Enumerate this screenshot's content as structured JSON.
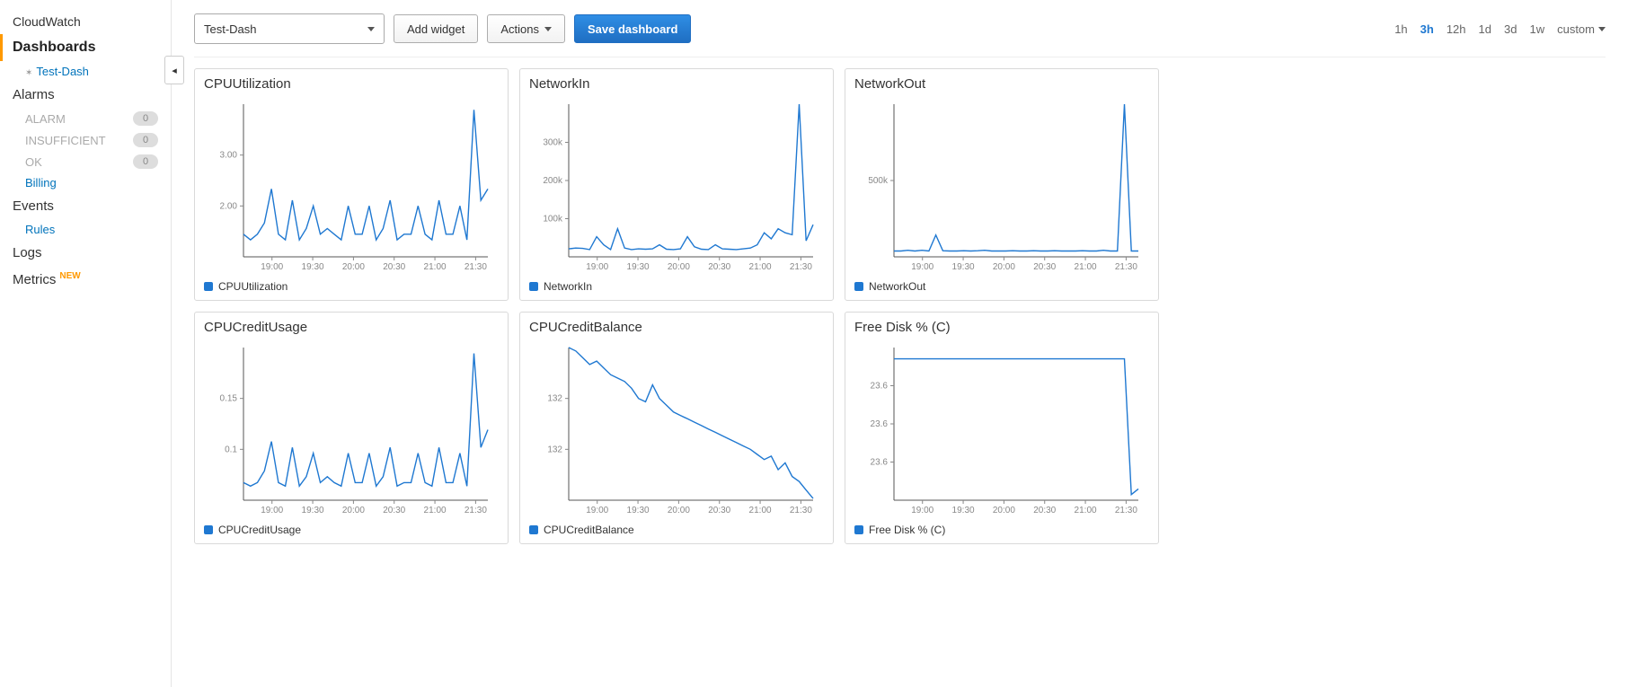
{
  "sidebar": {
    "top_label": "CloudWatch",
    "active_label": "Dashboards",
    "dash_item": "Test-Dash",
    "alarms_label": "Alarms",
    "alarm_states": [
      {
        "label": "ALARM",
        "count": "0"
      },
      {
        "label": "INSUFFICIENT",
        "count": "0"
      },
      {
        "label": "OK",
        "count": "0"
      }
    ],
    "billing_label": "Billing",
    "events_label": "Events",
    "rules_label": "Rules",
    "logs_label": "Logs",
    "metrics_label": "Metrics",
    "new_badge": "NEW"
  },
  "toolbar": {
    "dashboard_selected": "Test-Dash",
    "add_widget": "Add widget",
    "actions": "Actions",
    "save": "Save dashboard",
    "time_ranges": [
      "1h",
      "3h",
      "12h",
      "1d",
      "3d",
      "1w",
      "custom"
    ],
    "time_active": "3h"
  },
  "x_ticks": [
    "19:00",
    "19:30",
    "20:00",
    "20:30",
    "21:00",
    "21:30"
  ],
  "widgets": [
    {
      "title": "CPUUtilization",
      "legend": "CPUUtilization"
    },
    {
      "title": "NetworkIn",
      "legend": "NetworkIn"
    },
    {
      "title": "NetworkOut",
      "legend": "NetworkOut"
    },
    {
      "title": "CPUCreditUsage",
      "legend": "CPUCreditUsage"
    },
    {
      "title": "CPUCreditBalance",
      "legend": "CPUCreditBalance"
    },
    {
      "title": "Free Disk % (C)",
      "legend": "Free Disk % (C)"
    }
  ],
  "chart_data": [
    {
      "type": "line",
      "title": "CPUUtilization",
      "xlabel": "",
      "ylabel": "",
      "y_ticks": [
        "2.00",
        "3.00"
      ],
      "ylim": [
        1.3,
        4.0
      ],
      "x": [
        0,
        1,
        2,
        3,
        4,
        5,
        6,
        7,
        8,
        9,
        10,
        11,
        12,
        13,
        14,
        15,
        16,
        17,
        18,
        19,
        20,
        21,
        22,
        23,
        24,
        25,
        26,
        27,
        28,
        29,
        30,
        31,
        32,
        33,
        34,
        35
      ],
      "values": [
        1.7,
        1.6,
        1.7,
        1.9,
        2.5,
        1.7,
        1.6,
        2.3,
        1.6,
        1.8,
        2.2,
        1.7,
        1.8,
        1.7,
        1.6,
        2.2,
        1.7,
        1.7,
        2.2,
        1.6,
        1.8,
        2.3,
        1.6,
        1.7,
        1.7,
        2.2,
        1.7,
        1.6,
        2.3,
        1.7,
        1.7,
        2.2,
        1.6,
        3.9,
        2.3,
        2.5
      ]
    },
    {
      "type": "line",
      "title": "NetworkIn",
      "xlabel": "",
      "ylabel": "",
      "y_ticks": [
        "100k",
        "200k",
        "300k"
      ],
      "ylim": [
        0,
        380000
      ],
      "x": [
        0,
        1,
        2,
        3,
        4,
        5,
        6,
        7,
        8,
        9,
        10,
        11,
        12,
        13,
        14,
        15,
        16,
        17,
        18,
        19,
        20,
        21,
        22,
        23,
        24,
        25,
        26,
        27,
        28,
        29,
        30,
        31,
        32,
        33,
        34,
        35
      ],
      "values": [
        20000,
        22000,
        21000,
        18000,
        50000,
        30000,
        18000,
        70000,
        22000,
        18000,
        20000,
        19000,
        20000,
        30000,
        19000,
        18000,
        20000,
        50000,
        25000,
        19000,
        18000,
        30000,
        20000,
        19000,
        18000,
        20000,
        22000,
        30000,
        60000,
        45000,
        70000,
        60000,
        55000,
        380000,
        40000,
        80000
      ]
    },
    {
      "type": "line",
      "title": "NetworkOut",
      "xlabel": "",
      "ylabel": "",
      "y_ticks": [
        "500k"
      ],
      "ylim": [
        0,
        1050000
      ],
      "x": [
        0,
        1,
        2,
        3,
        4,
        5,
        6,
        7,
        8,
        9,
        10,
        11,
        12,
        13,
        14,
        15,
        16,
        17,
        18,
        19,
        20,
        21,
        22,
        23,
        24,
        25,
        26,
        27,
        28,
        29,
        30,
        31,
        32,
        33,
        34,
        35
      ],
      "values": [
        40000,
        40000,
        45000,
        40000,
        45000,
        40000,
        150000,
        42000,
        40000,
        40000,
        42000,
        40000,
        42000,
        45000,
        40000,
        40000,
        40000,
        42000,
        40000,
        40000,
        42000,
        40000,
        40000,
        42000,
        40000,
        40000,
        40000,
        42000,
        40000,
        40000,
        45000,
        40000,
        40000,
        1050000,
        40000,
        40000
      ]
    },
    {
      "type": "line",
      "title": "CPUCreditUsage",
      "xlabel": "",
      "ylabel": "",
      "y_ticks": [
        "0.1",
        "0.15"
      ],
      "ylim": [
        0.07,
        0.2
      ],
      "x": [
        0,
        1,
        2,
        3,
        4,
        5,
        6,
        7,
        8,
        9,
        10,
        11,
        12,
        13,
        14,
        15,
        16,
        17,
        18,
        19,
        20,
        21,
        22,
        23,
        24,
        25,
        26,
        27,
        28,
        29,
        30,
        31,
        32,
        33,
        34,
        35
      ],
      "values": [
        0.085,
        0.082,
        0.085,
        0.095,
        0.12,
        0.085,
        0.082,
        0.115,
        0.082,
        0.09,
        0.11,
        0.085,
        0.09,
        0.085,
        0.082,
        0.11,
        0.085,
        0.085,
        0.11,
        0.082,
        0.09,
        0.115,
        0.082,
        0.085,
        0.085,
        0.11,
        0.085,
        0.082,
        0.115,
        0.085,
        0.085,
        0.11,
        0.082,
        0.195,
        0.115,
        0.13
      ]
    },
    {
      "type": "line",
      "title": "CPUCreditBalance",
      "xlabel": "",
      "ylabel": "",
      "y_ticks": [
        "132",
        "132"
      ],
      "ylim": [
        127,
        136
      ],
      "x": [
        0,
        1,
        2,
        3,
        4,
        5,
        6,
        7,
        8,
        9,
        10,
        11,
        12,
        13,
        14,
        15,
        16,
        17,
        18,
        19,
        20,
        21,
        22,
        23,
        24,
        25,
        26,
        27,
        28,
        29,
        30,
        31,
        32,
        33,
        34,
        35
      ],
      "values": [
        136,
        135.8,
        135.4,
        135,
        135.2,
        134.8,
        134.4,
        134.2,
        134,
        133.6,
        133,
        132.8,
        133.8,
        133,
        132.6,
        132.2,
        132,
        131.8,
        131.6,
        131.4,
        131.2,
        131,
        130.8,
        130.6,
        130.4,
        130.2,
        130,
        129.7,
        129.4,
        129.6,
        128.8,
        129.2,
        128.4,
        128.1,
        127.6,
        127.1
      ]
    },
    {
      "type": "line",
      "title": "Free Disk % (C)",
      "xlabel": "",
      "ylabel": "",
      "y_ticks": [
        "23.6",
        "23.6",
        "23.6"
      ],
      "ylim": [
        23.45,
        23.72
      ],
      "x": [
        0,
        1,
        2,
        3,
        4,
        5,
        6,
        7,
        8,
        9,
        10,
        11,
        12,
        13,
        14,
        15,
        16,
        17,
        18,
        19,
        20,
        21,
        22,
        23,
        24,
        25,
        26,
        27,
        28,
        29,
        30,
        31,
        32,
        33,
        34,
        35
      ],
      "values": [
        23.7,
        23.7,
        23.7,
        23.7,
        23.7,
        23.7,
        23.7,
        23.7,
        23.7,
        23.7,
        23.7,
        23.7,
        23.7,
        23.7,
        23.7,
        23.7,
        23.7,
        23.7,
        23.7,
        23.7,
        23.7,
        23.7,
        23.7,
        23.7,
        23.7,
        23.7,
        23.7,
        23.7,
        23.7,
        23.7,
        23.7,
        23.7,
        23.7,
        23.7,
        23.46,
        23.47
      ]
    }
  ]
}
